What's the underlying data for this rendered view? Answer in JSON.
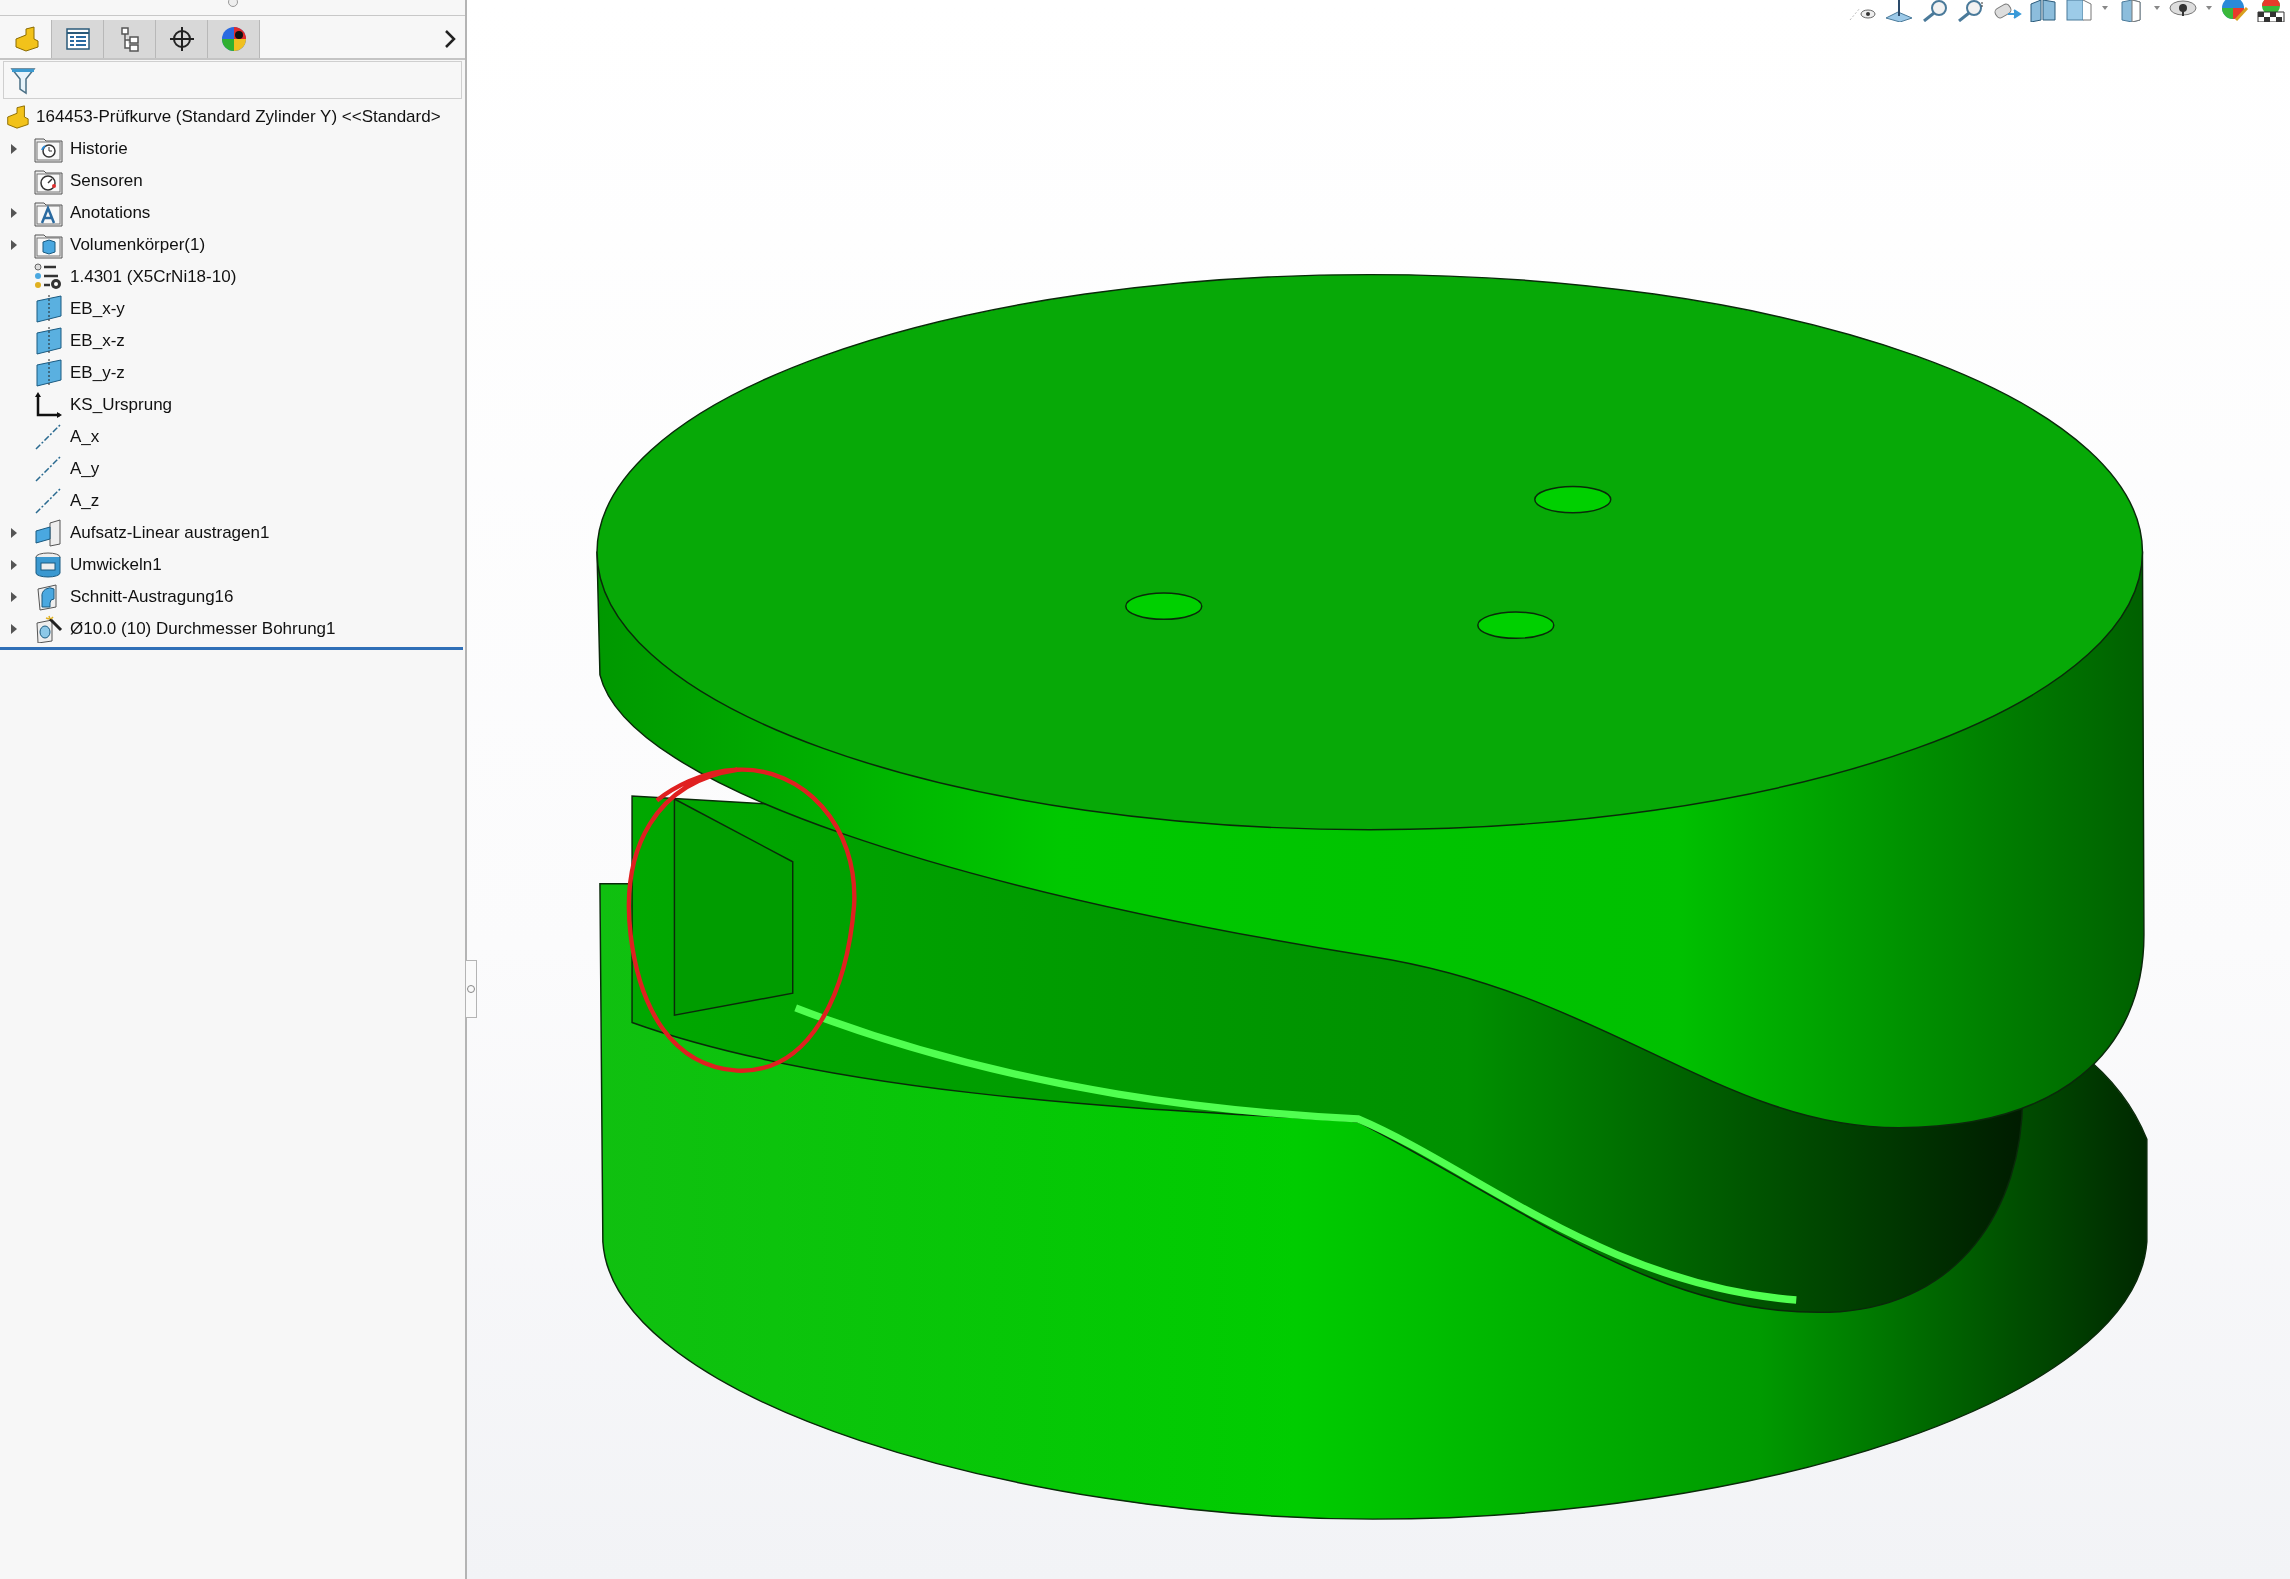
{
  "sidebar": {
    "tabs": [
      {
        "kind": "feature-manager",
        "selected": true
      },
      {
        "kind": "property-manager",
        "selected": false
      },
      {
        "kind": "configuration-manager",
        "selected": false
      },
      {
        "kind": "dimxpert",
        "selected": false
      },
      {
        "kind": "display-manager",
        "selected": false
      }
    ],
    "tree": {
      "root": {
        "label": "164453-Prüfkurve (Standard Zylinder Y) <<Standard>"
      },
      "items": [
        {
          "label": "Historie",
          "kind": "history",
          "expandable": true
        },
        {
          "label": "Sensoren",
          "kind": "sensors",
          "expandable": false
        },
        {
          "label": "Anotations",
          "kind": "annotations",
          "expandable": true
        },
        {
          "label": "Volumenkörper(1)",
          "kind": "bodies",
          "expandable": true
        },
        {
          "label": "1.4301 (X5CrNi18-10)",
          "kind": "material",
          "expandable": false
        },
        {
          "label": "EB_x-y",
          "kind": "plane",
          "expandable": false
        },
        {
          "label": "EB_x-z",
          "kind": "plane",
          "expandable": false
        },
        {
          "label": "EB_y-z",
          "kind": "plane",
          "expandable": false
        },
        {
          "label": "KS_Ursprung",
          "kind": "origin",
          "expandable": false
        },
        {
          "label": "A_x",
          "kind": "axis",
          "expandable": false
        },
        {
          "label": "A_y",
          "kind": "axis",
          "expandable": false
        },
        {
          "label": "A_z",
          "kind": "axis",
          "expandable": false
        },
        {
          "label": "Aufsatz-Linear austragen1",
          "kind": "extrude",
          "expandable": true
        },
        {
          "label": "Umwickeln1",
          "kind": "wrap",
          "expandable": true
        },
        {
          "label": "Schnitt-Austragung16",
          "kind": "sweep-cut",
          "expandable": true
        },
        {
          "label": "Ø10.0 (10) Durchmesser Bohrung1",
          "kind": "hole",
          "expandable": true
        }
      ]
    }
  }
}
